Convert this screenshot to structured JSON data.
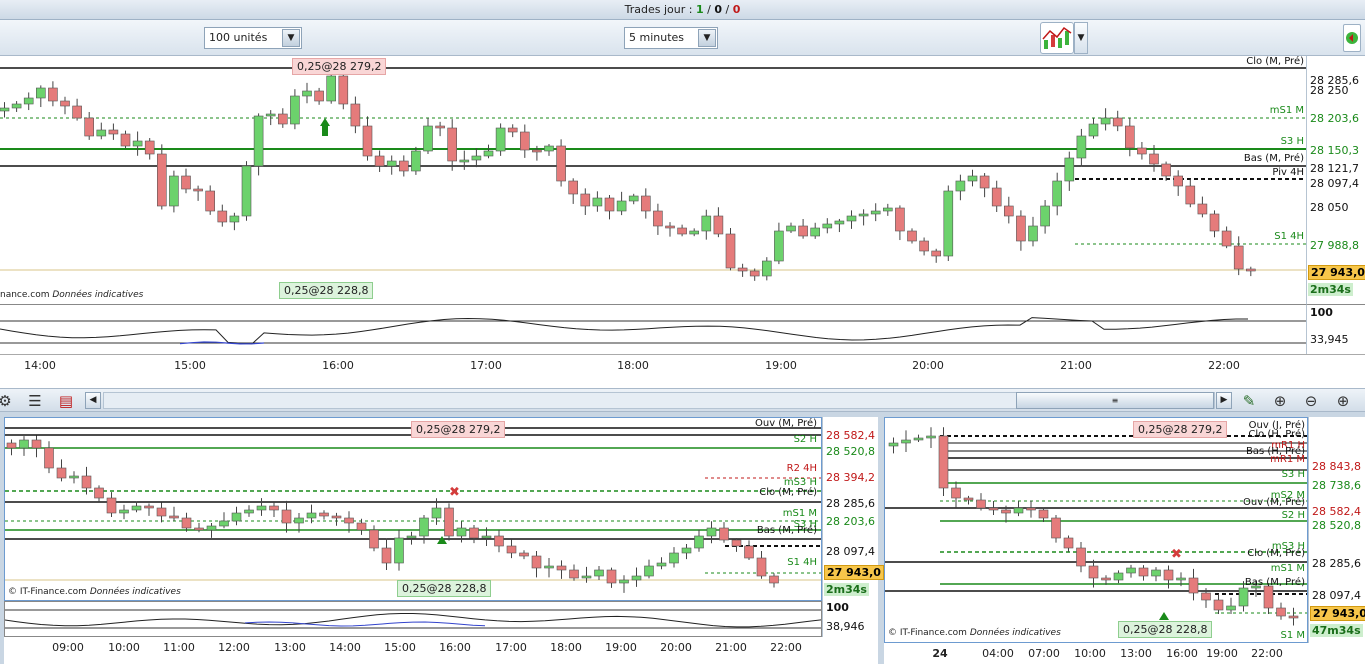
{
  "topbar": {
    "label": "Trades jour : ",
    "wins": "1",
    "sep1": " / ",
    "neutral": "0",
    "sep2": " / ",
    "losses": "0"
  },
  "toolbar": {
    "quantity": "100 unités",
    "timeframe": "5 minutes"
  },
  "icons": {
    "chart_type": "chart-type-icon",
    "dropdown": "chevron-down-icon",
    "bar_icon1": "chart-settings-icon",
    "bar_icon2": "list-icon",
    "bar_icon3": "indicator-icon",
    "wrench": "wrench-icon",
    "zoom_fit": "zoom-fit-icon",
    "zoom_out": "zoom-out-icon",
    "zoom_in": "zoom-in-icon"
  },
  "colors": {
    "up": "#6cd26c",
    "down": "#e57b7b",
    "level_green": "#1a8a1a",
    "level_red": "#c01818",
    "current": "#f7c64a"
  },
  "main": {
    "credit": "nance.com",
    "credit_note": "Données indicatives",
    "trade_sell": "0,25@28 279,2",
    "trade_buy": "0,25@28 228,8",
    "levels": [
      {
        "text": "Clo (M, Pré)",
        "cls": "bk"
      },
      {
        "text": "mS1 M",
        "cls": "gr"
      },
      {
        "text": "S3 H",
        "cls": "gr"
      },
      {
        "text": "Bas (M, Pré)",
        "cls": "bk"
      },
      {
        "text": "Piv 4H",
        "cls": "bk"
      },
      {
        "text": "S1 4H",
        "cls": "gr"
      }
    ],
    "prices": [
      {
        "text": "28 285,6",
        "cls": "bk"
      },
      {
        "text": "28 250",
        "cls": "bk"
      },
      {
        "text": "28 203,6",
        "cls": "gr"
      },
      {
        "text": "28 150,3",
        "cls": "gr"
      },
      {
        "text": "28 121,7",
        "cls": "bk"
      },
      {
        "text": "28 097,4",
        "cls": "bk"
      },
      {
        "text": "28 050",
        "cls": "bk"
      },
      {
        "text": "27 988,8",
        "cls": "gr"
      }
    ],
    "current_price": "27 943,0",
    "timer": "2m34s",
    "osc_value_top": "100",
    "osc_value": "33,945",
    "times": [
      "14:00",
      "15:00",
      "16:00",
      "17:00",
      "18:00",
      "19:00",
      "20:00",
      "21:00",
      "22:00"
    ]
  },
  "bottom_left": {
    "credit": "© IT-Finance.com",
    "credit_note": "Données indicatives",
    "trade_sell": "0,25@28 279,2",
    "trade_buy": "0,25@28 228,8",
    "levels": [
      {
        "text": "Ouv (M, Pré)",
        "cls": "bk"
      },
      {
        "text": "S2 H",
        "cls": "gr"
      },
      {
        "text": "R2 4H",
        "cls": "rd"
      },
      {
        "text": "mS3 H",
        "cls": "gr"
      },
      {
        "text": "Clo (M, Pré)",
        "cls": "bk"
      },
      {
        "text": "mS1 M",
        "cls": "gr"
      },
      {
        "text": "S3 H",
        "cls": "gr"
      },
      {
        "text": "Bas (M, Pré)",
        "cls": "bk"
      },
      {
        "text": "S1 4H",
        "cls": "gr"
      }
    ],
    "prices": [
      {
        "text": "28 582,4",
        "cls": "rd"
      },
      {
        "text": "28 520,8",
        "cls": "gr"
      },
      {
        "text": "28 394,2",
        "cls": "rd"
      },
      {
        "text": "28 285,6",
        "cls": "bk"
      },
      {
        "text": "28 203,6",
        "cls": "gr"
      },
      {
        "text": "28 097,4",
        "cls": "bk"
      }
    ],
    "current_price": "27 943,0",
    "timer": "2m34s",
    "osc_value_top": "100",
    "osc_value": "38,946",
    "times": [
      "09:00",
      "10:00",
      "11:00",
      "12:00",
      "13:00",
      "14:00",
      "15:00",
      "16:00",
      "17:00",
      "18:00",
      "19:00",
      "20:00",
      "21:00",
      "22:00"
    ]
  },
  "bottom_right": {
    "credit": "© IT-Finance.com",
    "credit_note": "Données indicatives",
    "trade_sell": "0,25@28 279,2",
    "trade_buy": "0,25@28 228,8",
    "levels": [
      {
        "text": "Ouv (J, Pré)",
        "cls": "bk"
      },
      {
        "text": "Clo (H, Pré)",
        "cls": "bk"
      },
      {
        "text": "mR1 H",
        "cls": "rd"
      },
      {
        "text": "Bas (H, Pré)",
        "cls": "bk"
      },
      {
        "text": "mR1 M",
        "cls": "rd"
      },
      {
        "text": "S3 H",
        "cls": "gr"
      },
      {
        "text": "mS2 M",
        "cls": "gr"
      },
      {
        "text": "Ouv (M, Pré)",
        "cls": "bk"
      },
      {
        "text": "S2 H",
        "cls": "gr"
      },
      {
        "text": "mS3 H",
        "cls": "gr"
      },
      {
        "text": "Clo (M, Pré)",
        "cls": "bk"
      },
      {
        "text": "mS1 M",
        "cls": "gr"
      },
      {
        "text": "Bas (M, Pré)",
        "cls": "bk"
      },
      {
        "text": "S1 M",
        "cls": "gr"
      }
    ],
    "prices": [
      {
        "text": "28 843,8",
        "cls": "rd"
      },
      {
        "text": "28 738,6",
        "cls": "gr"
      },
      {
        "text": "28 582,4",
        "cls": "rd"
      },
      {
        "text": "28 520,8",
        "cls": "gr"
      },
      {
        "text": "28 285,6",
        "cls": "bk"
      },
      {
        "text": "28 097,4",
        "cls": "bk"
      }
    ],
    "current_price": "27 943,0",
    "timer": "47m34s",
    "times": [
      "24",
      "04:00",
      "07:00",
      "10:00",
      "13:00",
      "16:00",
      "19:00",
      "22:00"
    ]
  }
}
